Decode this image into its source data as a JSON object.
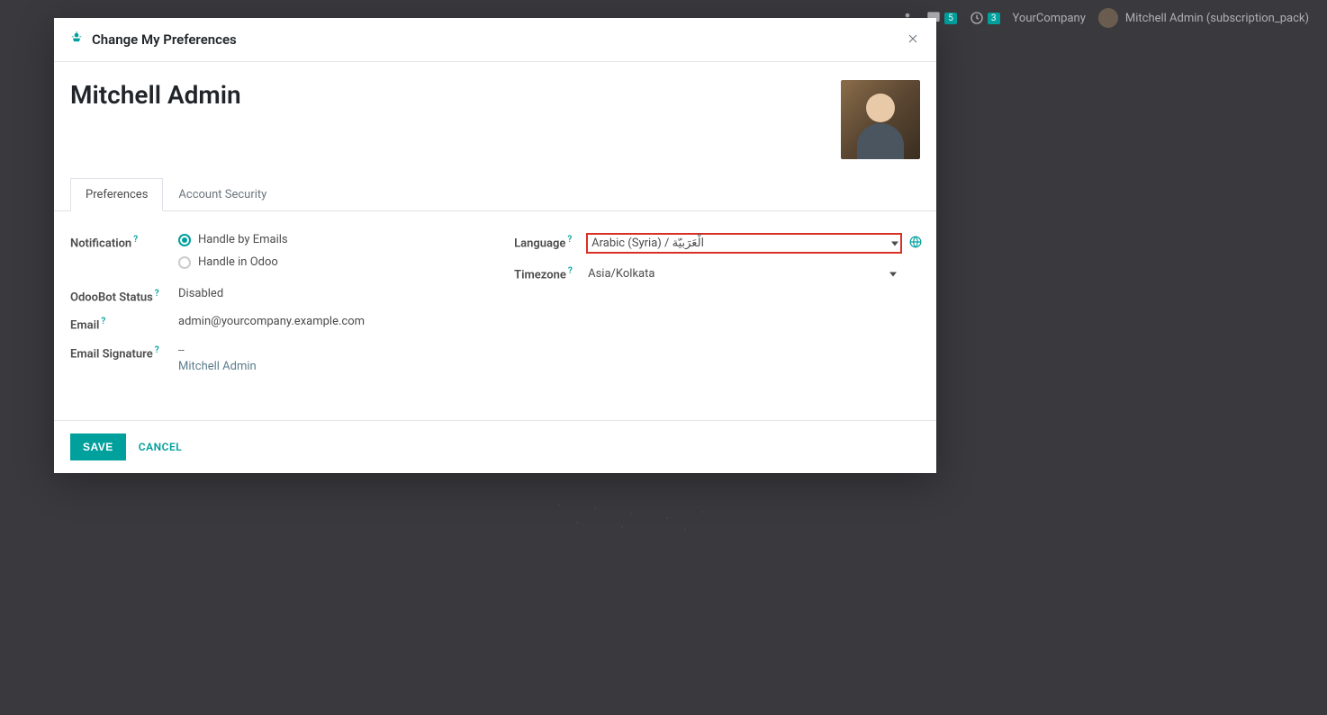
{
  "topBar": {
    "messagesBadge": "5",
    "activitiesBadge": "3",
    "companyName": "YourCompany",
    "userDisplay": "Mitchell Admin (subscription_pack)"
  },
  "modal": {
    "title": "Change My Preferences",
    "userName": "Mitchell Admin",
    "tabs": [
      {
        "label": "Preferences",
        "active": true
      },
      {
        "label": "Account Security",
        "active": false
      }
    ],
    "labels": {
      "notification": "Notification",
      "odoobotStatus": "OdooBot Status",
      "email": "Email",
      "emailSignature": "Email Signature",
      "language": "Language",
      "timezone": "Timezone"
    },
    "notificationOptions": [
      {
        "label": "Handle by Emails",
        "checked": true
      },
      {
        "label": "Handle in Odoo",
        "checked": false
      }
    ],
    "odoobotStatus": "Disabled",
    "email": "admin@yourcompany.example.com",
    "signatureLine1": "--",
    "signatureLine2": "Mitchell Admin",
    "languageValue": "Arabic (Syria) / الْعَرَبيّة",
    "timezoneValue": "Asia/Kolkata",
    "buttons": {
      "save": "SAVE",
      "cancel": "CANCEL"
    }
  }
}
